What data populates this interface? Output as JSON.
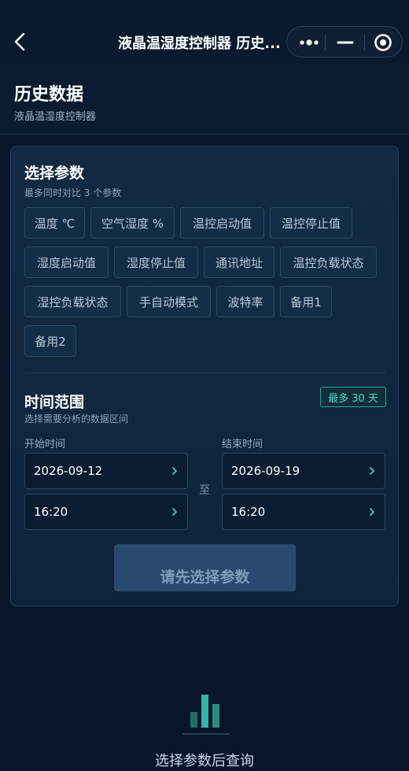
{
  "nav": {
    "title": "液晶温湿度控制器 历史...",
    "back_icon": "chevron-left-icon",
    "more_icon": "more-dots-icon",
    "minimize_icon": "minus-icon",
    "close_icon": "target-circle-icon"
  },
  "header": {
    "title": "历史数据",
    "subtitle": "液晶温湿度控制器"
  },
  "params": {
    "title": "选择参数",
    "subtitle": "最多同时对比 3 个参数",
    "chips": [
      "温度 ℃",
      "空气湿度 %",
      "温控启动值",
      "温控停止值",
      "湿度启动值",
      "湿度停止值",
      "通讯地址",
      "温控负载状态",
      "湿控负载状态",
      "手自动模式",
      "波特率",
      "备用1",
      "备用2"
    ]
  },
  "time_range": {
    "title": "时间范围",
    "subtitle": "选择需要分析的数据区间",
    "badge": "最多 30 天",
    "start_label": "开始时间",
    "end_label": "结束时间",
    "start_date": "2026-09-12",
    "start_time": "16:20",
    "end_date": "2026-09-19",
    "end_time": "16:20",
    "to_label": "至"
  },
  "query_button": {
    "label": "请先选择参数",
    "disabled": true
  },
  "empty_state": {
    "icon": "bar-chart-icon",
    "text": "选择参数后查询"
  },
  "colors": {
    "background": "#07162a",
    "card": "#112a42",
    "accent": "#2fa69a",
    "button_disabled": "#2a4a6d"
  }
}
